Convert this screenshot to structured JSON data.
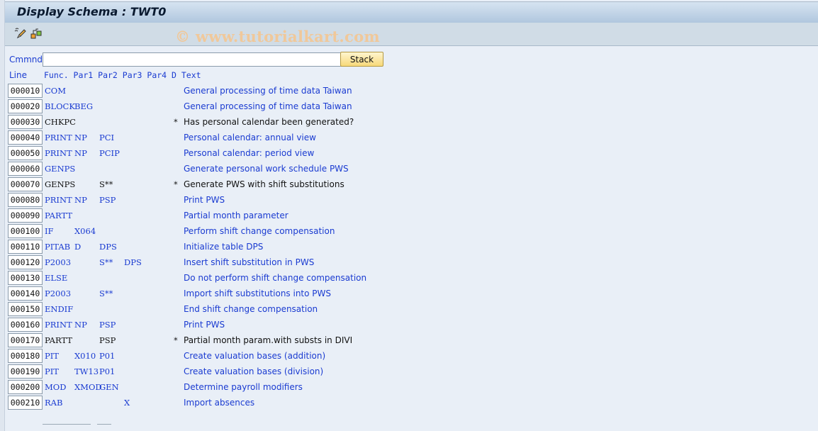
{
  "window": {
    "title": "Display Schema : TWT0"
  },
  "toolbar": {
    "icons": [
      "edit-pencil-icon",
      "hierarchy-structure-icon"
    ],
    "watermark": "© www.tutorialkart.com"
  },
  "command": {
    "label": "Cmmnd",
    "value": "",
    "placeholder": "",
    "stack_label": "Stack"
  },
  "columns": {
    "line": "Line",
    "rest": "Func. Par1 Par2 Par3 Par4 D Text"
  },
  "colors": {
    "link_blue": "#1a3bd1",
    "comment_black": "#111111",
    "stack_button": "#f7d97a"
  },
  "rows": [
    {
      "line": "000010",
      "func": "COM",
      "par1": "",
      "par2": "",
      "par3": "",
      "par4": "",
      "d": "",
      "text": "General processing of time data Taiwan",
      "comment": false
    },
    {
      "line": "000020",
      "func": "BLOCK",
      "par1": "BEG",
      "par2": "",
      "par3": "",
      "par4": "",
      "d": "",
      "text": "General processing of time data Taiwan",
      "comment": false
    },
    {
      "line": "000030",
      "func": "CHKPC",
      "par1": "",
      "par2": "",
      "par3": "",
      "par4": "",
      "d": "*",
      "text": "Has personal calendar been generated?",
      "comment": true
    },
    {
      "line": "000040",
      "func": "PRINT",
      "par1": "NP",
      "par2": "PCI",
      "par3": "",
      "par4": "",
      "d": "",
      "text": "Personal calendar: annual view",
      "comment": false
    },
    {
      "line": "000050",
      "func": "PRINT",
      "par1": "NP",
      "par2": "PCIP",
      "par3": "",
      "par4": "",
      "d": "",
      "text": "Personal calendar: period view",
      "comment": false
    },
    {
      "line": "000060",
      "func": "GENPS",
      "par1": "",
      "par2": "",
      "par3": "",
      "par4": "",
      "d": "",
      "text": "Generate personal work schedule PWS",
      "comment": false
    },
    {
      "line": "000070",
      "func": "GENPS",
      "par1": "",
      "par2": "S**",
      "par3": "",
      "par4": "",
      "d": "*",
      "text": "Generate PWS with shift substitutions",
      "comment": true
    },
    {
      "line": "000080",
      "func": "PRINT",
      "par1": "NP",
      "par2": "PSP",
      "par3": "",
      "par4": "",
      "d": "",
      "text": "Print PWS",
      "comment": false
    },
    {
      "line": "000090",
      "func": "PARTT",
      "par1": "",
      "par2": "",
      "par3": "",
      "par4": "",
      "d": "",
      "text": "Partial month parameter",
      "comment": false
    },
    {
      "line": "000100",
      "func": "IF",
      "par1": "X064",
      "par2": "",
      "par3": "",
      "par4": "",
      "d": "",
      "text": "Perform shift change compensation",
      "comment": false
    },
    {
      "line": "000110",
      "func": "PITAB",
      "par1": "D",
      "par2": "DPS",
      "par3": "",
      "par4": "",
      "d": "",
      "text": "Initialize table DPS",
      "comment": false
    },
    {
      "line": "000120",
      "func": "P2003",
      "par1": "",
      "par2": "S**",
      "par3": "DPS",
      "par4": "",
      "d": "",
      "text": "Insert shift substitution in PWS",
      "comment": false
    },
    {
      "line": "000130",
      "func": "ELSE",
      "par1": "",
      "par2": "",
      "par3": "",
      "par4": "",
      "d": "",
      "text": "Do not perform shift change compensation",
      "comment": false
    },
    {
      "line": "000140",
      "func": "P2003",
      "par1": "",
      "par2": "S**",
      "par3": "",
      "par4": "",
      "d": "",
      "text": "Import shift substitutions into PWS",
      "comment": false
    },
    {
      "line": "000150",
      "func": "ENDIF",
      "par1": "",
      "par2": "",
      "par3": "",
      "par4": "",
      "d": "",
      "text": "End shift change compensation",
      "comment": false
    },
    {
      "line": "000160",
      "func": "PRINT",
      "par1": "NP",
      "par2": "PSP",
      "par3": "",
      "par4": "",
      "d": "",
      "text": "Print PWS",
      "comment": false
    },
    {
      "line": "000170",
      "func": "PARTT",
      "par1": "",
      "par2": "PSP",
      "par3": "",
      "par4": "",
      "d": "*",
      "text": "Partial month param.with substs in DIVI",
      "comment": true
    },
    {
      "line": "000180",
      "func": "PIT",
      "par1": "X010",
      "par2": "P01",
      "par3": "",
      "par4": "",
      "d": "",
      "text": "Create valuation bases (addition)",
      "comment": false
    },
    {
      "line": "000190",
      "func": "PIT",
      "par1": "TW13",
      "par2": "P01",
      "par3": "",
      "par4": "",
      "d": "",
      "text": "Create valuation bases (division)",
      "comment": false
    },
    {
      "line": "000200",
      "func": "MOD",
      "par1": "XMOD",
      "par2": "GEN",
      "par3": "",
      "par4": "",
      "d": "",
      "text": "Determine payroll modifiers",
      "comment": false
    },
    {
      "line": "000210",
      "func": "RAB",
      "par1": "",
      "par2": "",
      "par3": "X",
      "par4": "",
      "d": "",
      "text": "Import absences",
      "comment": false
    }
  ]
}
